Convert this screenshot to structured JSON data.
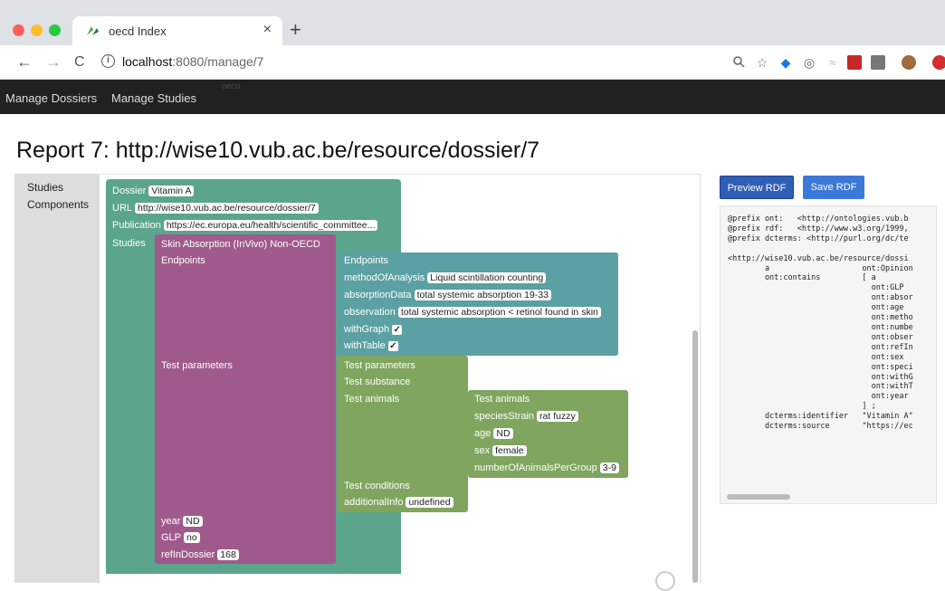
{
  "browser": {
    "tab_title": "oecd Index",
    "tab_close": "×",
    "new_tab": "+",
    "nav_back": "←",
    "nav_forward": "→",
    "nav_reload": "C",
    "url_info": "i",
    "url_host": "localhost",
    "url_path": ":8080/manage/7"
  },
  "appnav": {
    "items": [
      "Manage Dossiers",
      "Manage Studies"
    ],
    "faint_label": "OECD"
  },
  "page": {
    "title": "Report 7: http://wise10.vub.ac.be/resource/dossier/7"
  },
  "sidebar": {
    "items": [
      "Studies",
      "Components"
    ]
  },
  "blocks": {
    "dossier": {
      "dossier_label": "Dossier",
      "dossier_value": "Vitamin A",
      "url_label": "URL",
      "url_value": "http://wise10.vub.ac.be/resource/dossier/7",
      "publication_label": "Publication",
      "publication_value": "https://ec.europa.eu/health/scientific_committee...",
      "studies_label": "Studies"
    },
    "study": {
      "title": "Skin Absorption (InVivo) Non-OECD",
      "endpoints_label": "Endpoints",
      "test_parameters_label": "Test parameters",
      "year_label": "year",
      "year_value": "ND",
      "glp_label": "GLP",
      "glp_value": "no",
      "ref_label": "refInDossier",
      "ref_value": "168"
    },
    "endpoints": {
      "title": "Endpoints",
      "method_label": "methodOfAnalysis",
      "method_value": "Liquid scintillation counting",
      "absorption_label": "absorptionData",
      "absorption_value": "total systemic absorption 19-33",
      "observation_label": "observation",
      "observation_value": "total systemic absorption < retinol found in skin",
      "graph_label": "withGraph",
      "table_label": "withTable",
      "checkmark": "✓"
    },
    "test_parameters": {
      "title": "Test parameters",
      "substance_label": "Test substance",
      "animals_label": "Test animals",
      "conditions_label": "Test conditions",
      "additional_label": "additionalInfo",
      "additional_value": "undefined"
    },
    "test_animals": {
      "title": "Test animals",
      "species_label": "speciesStrain",
      "species_value": "rat fuzzy",
      "age_label": "age",
      "age_value": "ND",
      "sex_label": "sex",
      "sex_value": "female",
      "number_label": "numberOfAnimalsPerGroup",
      "number_value": "3-9"
    }
  },
  "rdf": {
    "preview_label": "Preview RDF",
    "save_label": "Save RDF",
    "lines": [
      "@prefix ont:   <http://ontologies.vub.b",
      "@prefix rdf:   <http://www.w3.org/1999,",
      "@prefix dcterms: <http://purl.org/dc/te",
      "",
      "<http://wise10.vub.ac.be/resource/dossi",
      "        a                    ont:Opinion",
      "        ont:contains         [ a",
      "                               ont:GLP",
      "                               ont:absor",
      "                               ont:age",
      "                               ont:metho",
      "                               ont:numbe",
      "                               ont:obser",
      "                               ont:refIn",
      "                               ont:sex",
      "                               ont:speci",
      "                               ont:withG",
      "                               ont:withT",
      "                               ont:year",
      "                             ] ;",
      "        dcterms:identifier   \"Vitamin A\"",
      "        dcterms:source       \"https://ec"
    ]
  },
  "colors": {
    "dossier_block": "#5ba58c",
    "study_block": "#9f5a8b",
    "endpoints_block": "#5ba0a2",
    "params_block": "#7fa55f",
    "preview_button": "#2f5fb4",
    "save_button": "#3c78d8"
  }
}
